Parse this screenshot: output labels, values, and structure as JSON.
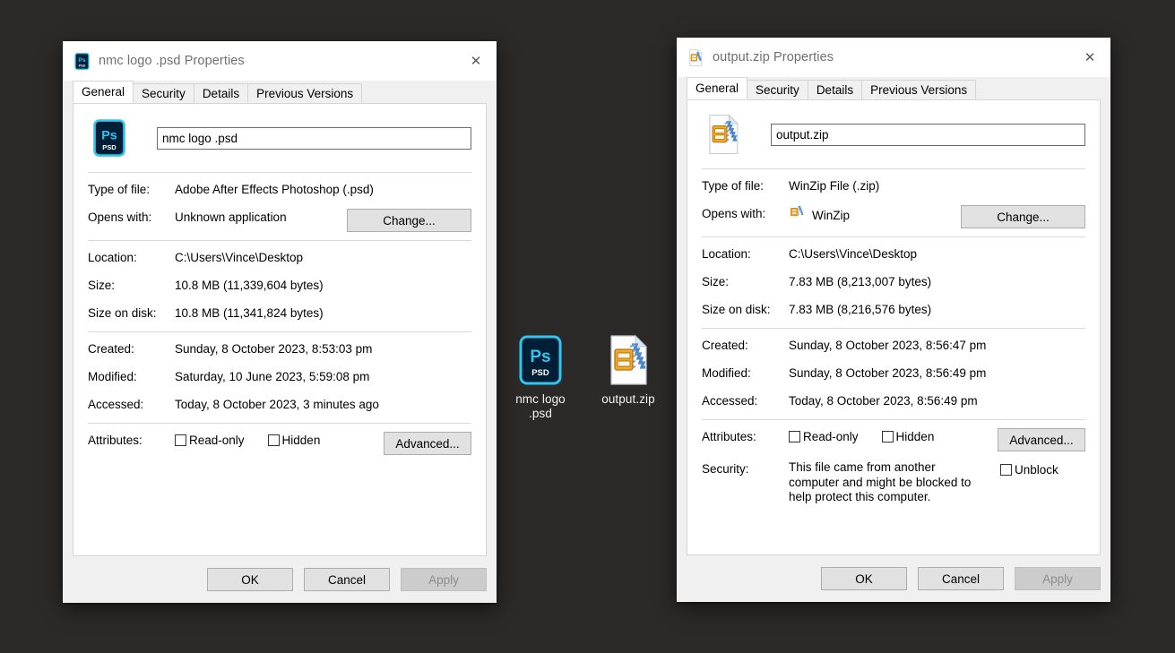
{
  "desktop": {
    "background_color": "#2b2a29",
    "icons": [
      {
        "name": "nmc logo .psd",
        "icon": "photoshop-psd-file-icon",
        "caption_line1": "nmc logo",
        "caption_line2": ".psd"
      },
      {
        "name": "output.zip",
        "icon": "winzip-archive-file-icon",
        "caption_line1": "output.zip",
        "caption_line2": ""
      }
    ]
  },
  "dialogs": [
    {
      "id": "psd",
      "title": "nmc logo .psd Properties",
      "title_icon": "photoshop-psd-file-icon",
      "close_label": "✕",
      "tabs": [
        {
          "label": "General",
          "active": true
        },
        {
          "label": "Security",
          "active": false
        },
        {
          "label": "Details",
          "active": false
        },
        {
          "label": "Previous Versions",
          "active": false
        }
      ],
      "file_icon": "photoshop-psd-file-icon",
      "filename_value": "nmc logo .psd",
      "fields": {
        "type_of_file_label": "Type of file:",
        "type_of_file_value": "Adobe After Effects Photoshop (.psd)",
        "opens_with_label": "Opens with:",
        "opens_with_value": "Unknown application",
        "opens_with_icon": "",
        "change_button": "Change...",
        "location_label": "Location:",
        "location_value": "C:\\Users\\Vince\\Desktop",
        "size_label": "Size:",
        "size_value": "10.8 MB (11,339,604 bytes)",
        "size_on_disk_label": "Size on disk:",
        "size_on_disk_value": "10.8 MB (11,341,824 bytes)",
        "created_label": "Created:",
        "created_value": "Sunday, 8 October 2023, 8:53:03 pm",
        "modified_label": "Modified:",
        "modified_value": "Saturday, 10 June 2023, 5:59:08 pm",
        "accessed_label": "Accessed:",
        "accessed_value": "Today, 8 October 2023, 3 minutes ago",
        "attributes_label": "Attributes:",
        "readonly_label": "Read-only",
        "hidden_label": "Hidden",
        "advanced_button": "Advanced..."
      },
      "footer": {
        "ok": "OK",
        "cancel": "Cancel",
        "apply": "Apply",
        "apply_disabled": true
      }
    },
    {
      "id": "zip",
      "title": "output.zip Properties",
      "title_icon": "winzip-archive-file-icon",
      "close_label": "✕",
      "tabs": [
        {
          "label": "General",
          "active": true
        },
        {
          "label": "Security",
          "active": false
        },
        {
          "label": "Details",
          "active": false
        },
        {
          "label": "Previous Versions",
          "active": false
        }
      ],
      "file_icon": "winzip-archive-file-icon",
      "filename_value": "output.zip",
      "fields": {
        "type_of_file_label": "Type of file:",
        "type_of_file_value": "WinZip File (.zip)",
        "opens_with_label": "Opens with:",
        "opens_with_value": "WinZip",
        "opens_with_icon": "winzip-app-icon",
        "change_button": "Change...",
        "location_label": "Location:",
        "location_value": "C:\\Users\\Vince\\Desktop",
        "size_label": "Size:",
        "size_value": "7.83 MB (8,213,007 bytes)",
        "size_on_disk_label": "Size on disk:",
        "size_on_disk_value": "7.83 MB (8,216,576 bytes)",
        "created_label": "Created:",
        "created_value": "Sunday, 8 October 2023, 8:56:47 pm",
        "modified_label": "Modified:",
        "modified_value": "Sunday, 8 October 2023, 8:56:49 pm",
        "accessed_label": "Accessed:",
        "accessed_value": "Today, 8 October 2023, 8:56:49 pm",
        "attributes_label": "Attributes:",
        "readonly_label": "Read-only",
        "hidden_label": "Hidden",
        "advanced_button": "Advanced...",
        "security_label": "Security:",
        "security_text": "This file came from another computer and might be blocked to help protect this computer.",
        "unblock_label": "Unblock"
      },
      "footer": {
        "ok": "OK",
        "cancel": "Cancel",
        "apply": "Apply",
        "apply_disabled": true
      }
    }
  ],
  "colors": {
    "desktop": "#2b2a29",
    "dialog_face": "#f0f0f0",
    "page": "#ffffff",
    "title_text": "#6f6f6f",
    "psd_accent": "#31c5f0",
    "psd_dark": "#001e36",
    "zip_accent": "#f5a623"
  }
}
